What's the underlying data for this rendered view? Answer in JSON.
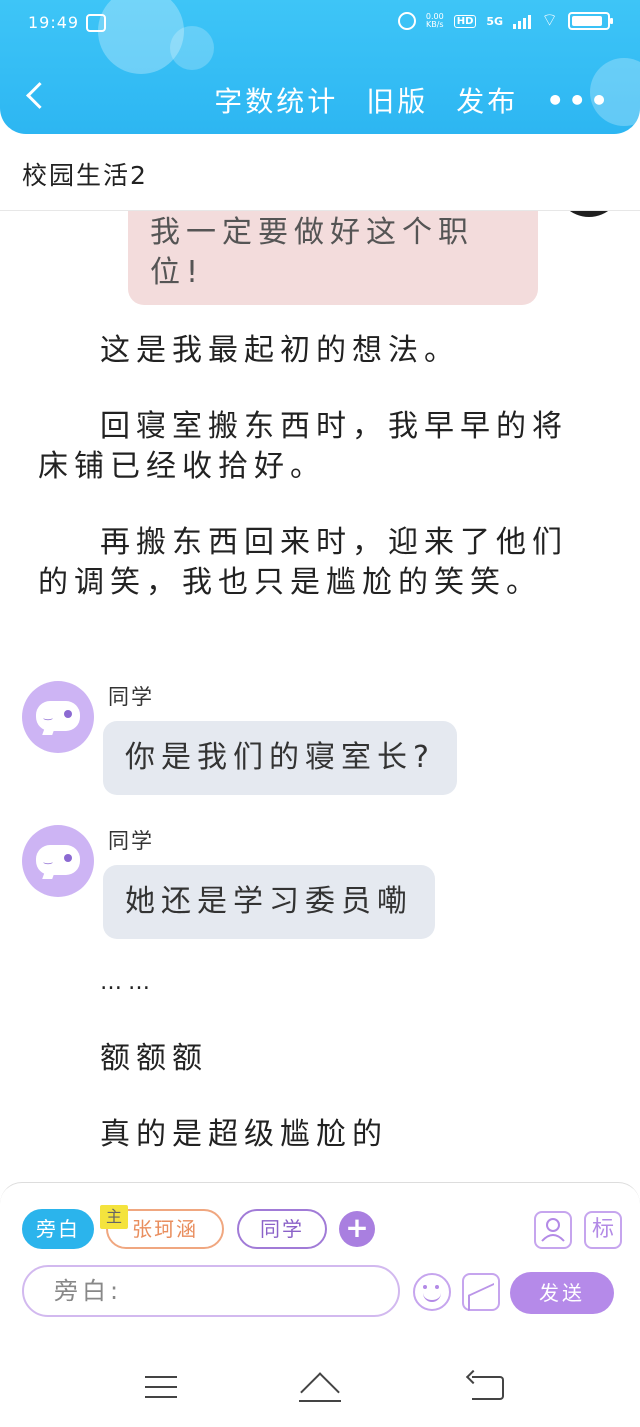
{
  "status_bar": {
    "time": "19:49",
    "net_speed_value": "0.00",
    "net_speed_unit": "KB/s",
    "hd_label": "HD",
    "network_label": "5G"
  },
  "header": {
    "nav": {
      "word_count": "字数统计",
      "old_version": "旧版",
      "publish": "发布",
      "more": "•••"
    }
  },
  "document": {
    "title": "校园生活2"
  },
  "story": {
    "pink_bubble_text": "我一定要做好这个职位!",
    "paragraphs": [
      "这是我最起初的想法。",
      "回寝室搬东西时，我早早的将床铺已经收拾好。",
      "再搬东西回来时，迎来了他们的调笑，我也只是尴尬的笑笑。"
    ],
    "messages": [
      {
        "speaker": "同学",
        "text": "你是我们的寝室长?"
      },
      {
        "speaker": "同学",
        "text": "她还是学习委员嘞"
      }
    ],
    "after_paragraphs": [
      "……",
      "额额额",
      "真的是超级尴尬的"
    ]
  },
  "input_panel": {
    "roles": {
      "narrator": "旁白",
      "main_tag": "主",
      "main_role": "张珂涵",
      "classmate": "同学"
    },
    "add_label": "+",
    "tag_button_label": "标",
    "input_placeholder": "旁白:",
    "send_label": "发送"
  },
  "colors": {
    "header_blue": "#2db6f2",
    "accent_purple": "#b58ae9",
    "pink_bubble": "#f3dcdc",
    "chat_bubble": "#e5e9f0"
  },
  "icons": [
    "back-arrow-icon",
    "alarm-icon",
    "wifi-icon",
    "battery-icon",
    "more-icon",
    "avatar-icon",
    "role-icon",
    "emoji-icon",
    "image-icon",
    "menu-icon",
    "home-icon",
    "nav-back-icon"
  ]
}
